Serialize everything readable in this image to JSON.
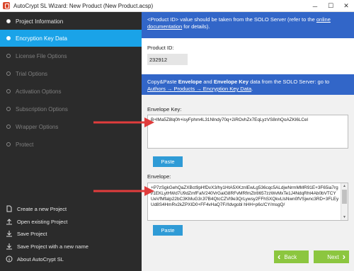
{
  "window": {
    "title": "AutoCrypt SL Wizard: New Product (New Product.acsp)",
    "minimize": "─",
    "maximize": "☐",
    "close": "✕"
  },
  "sidebar": {
    "steps": [
      {
        "label": "Project Information",
        "state": "done"
      },
      {
        "label": "Encryption Key Data",
        "state": "active"
      },
      {
        "label": "License File Options",
        "state": "pending"
      },
      {
        "label": "Trial Options",
        "state": "pending"
      },
      {
        "label": "Activation Options",
        "state": "pending"
      },
      {
        "label": "Subscription Options",
        "state": "pending"
      },
      {
        "label": "Wrapper Options",
        "state": "pending"
      },
      {
        "label": "Protect",
        "state": "pending"
      }
    ],
    "actions": [
      {
        "label": "Create a new Project",
        "icon": "new-project-icon"
      },
      {
        "label": "Open existing Project",
        "icon": "open-project-icon"
      },
      {
        "label": "Save Project",
        "icon": "save-icon"
      },
      {
        "label": "Save Project with a new name",
        "icon": "save-as-icon"
      },
      {
        "label": "About AutoCrypt SL",
        "icon": "info-icon"
      }
    ]
  },
  "main": {
    "banner1": {
      "pre": "<Product ID> value should be taken from the SOLO Server (refer to the ",
      "link": "online documentation",
      "post": " for details)."
    },
    "product_id_label": "Product ID:",
    "product_id_value": "232912",
    "banner2": {
      "t1": "Copy&Paste ",
      "b1": "Envelope",
      "t2": " and ",
      "b2": "Envelope Key",
      "t3": " data from the SOLO Server: go to ",
      "link": "Authors → Products → Encryption Key Data",
      "t4": "."
    },
    "envelope_key_label": "Envelope Key:",
    "envelope_key_value": "B+lMa5Z8lq0h+isyFphm4L31Nlndy70q+2iROvhZx7EqLyzVS8nhQoAZKl6LCel",
    "paste_label": "Paste",
    "envelope_label": "Envelope:",
    "envelope_value": "+P7zSgkGehQaZXBct9pHfDvX3/hy1HtA5XKznlEwLg536cqc5ALdjwNrmMMR91E+3F65ia7rgi/1EKLytHWd7U9dZmfFalV240VrGaiG8RFvMRfmZtr8657zzWvMxTe1J4NdqRht4Ab0bVTCYUeVfMfalp22bC3KMuG3rJl7B4QtcCZVl9e3QrLywsy2FFhSXQkvLlsNwn0fVSjwnc3RD+3FLEyUd8S4HmRv2kZPXID0+FF4vHaQ7F//Idvgobl hHH+p6c/CY/msgQ/",
    "back_label": "Back",
    "next_label": "Next"
  }
}
